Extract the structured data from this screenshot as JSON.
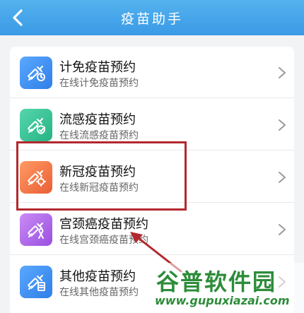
{
  "header": {
    "title": "疫苗助手"
  },
  "colors": {
    "header": "#3a9ae6",
    "highlight": "#b3282e",
    "watermark": "#2d8c3a"
  },
  "items": [
    {
      "title": "计免疫苗预约",
      "subtitle": "在线计免疫苗预约",
      "icon": "syringe-clock-icon",
      "icon_color": "#3b8ef0"
    },
    {
      "title": "流感疫苗预约",
      "subtitle": "在线流感疫苗预约",
      "icon": "syringe-shield-icon",
      "icon_color": "#35c49a"
    },
    {
      "title": "新冠疫苗预约",
      "subtitle": "在线新冠疫苗预约",
      "icon": "syringe-virus-icon",
      "icon_color": "#f07a4a"
    },
    {
      "title": "宫颈癌疫苗预约",
      "subtitle": "在线宫颈癌疫苗预约",
      "icon": "syringe-ribbon-icon",
      "icon_color": "#b46ae8"
    },
    {
      "title": "其他疫苗预约",
      "subtitle": "在线其他疫苗预约",
      "icon": "syringe-doc-icon",
      "icon_color": "#3b8ef0"
    }
  ],
  "watermark": {
    "main": "谷普软件园",
    "url": "www.gupuxiazai.com"
  }
}
